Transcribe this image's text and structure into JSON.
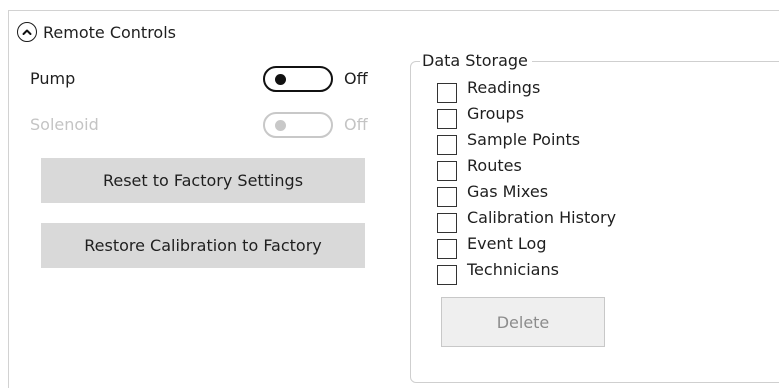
{
  "section": {
    "title": "Remote Controls",
    "icon": "chevron-up-icon"
  },
  "toggles": [
    {
      "label": "Pump",
      "state": "Off",
      "enabled": true
    },
    {
      "label": "Solenoid",
      "state": "Off",
      "enabled": false
    }
  ],
  "buttons": {
    "reset_factory": "Reset to Factory Settings",
    "restore_calibration": "Restore Calibration to Factory"
  },
  "data_storage": {
    "title": "Data Storage",
    "items": [
      {
        "label": "Readings",
        "checked": false
      },
      {
        "label": "Groups",
        "checked": false
      },
      {
        "label": "Sample Points",
        "checked": false
      },
      {
        "label": "Routes",
        "checked": false
      },
      {
        "label": "Gas Mixes",
        "checked": false
      },
      {
        "label": "Calibration History",
        "checked": false
      },
      {
        "label": "Event Log",
        "checked": false
      },
      {
        "label": "Technicians",
        "checked": false
      }
    ],
    "delete_label": "Delete",
    "delete_enabled": false
  },
  "colors": {
    "disabled_text": "#c4c4c4",
    "button_bg": "#d9d9d9",
    "border": "#d2d2d2"
  }
}
